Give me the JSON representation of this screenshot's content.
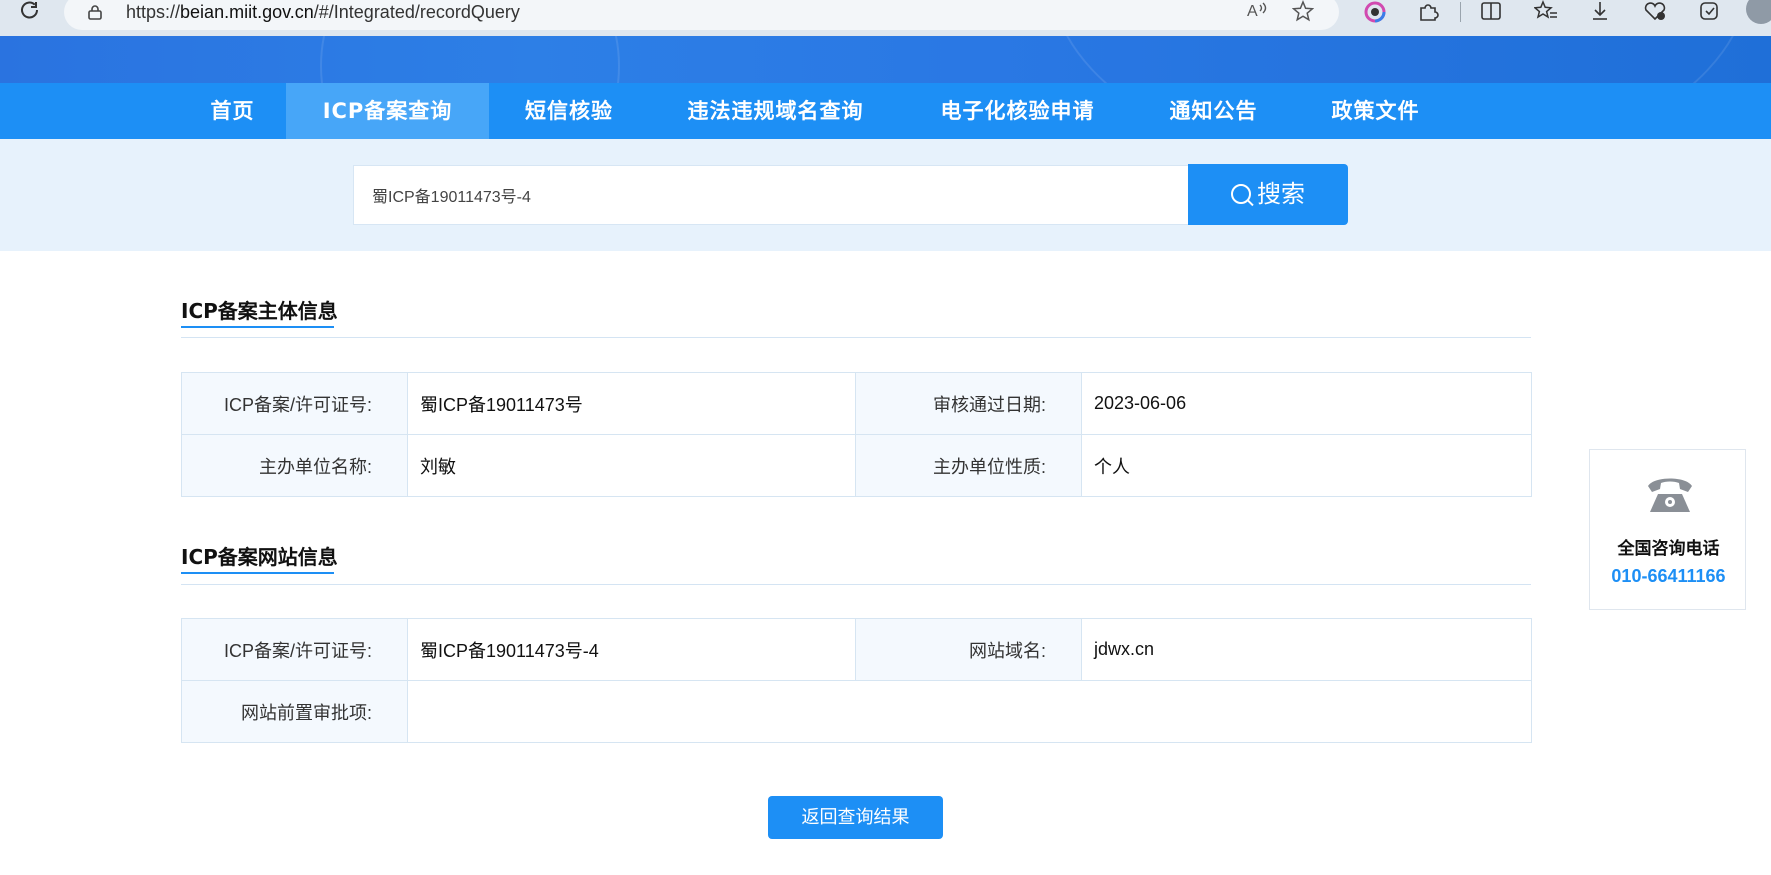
{
  "browser": {
    "url_prefix": "https://",
    "url_host": "beian.miit.gov.cn",
    "url_path": "/#/Integrated/recordQuery",
    "icons": [
      "refresh-icon",
      "lock-icon",
      "read-aloud-icon",
      "favorite-star-icon",
      "browser-essentials-icon",
      "extensions-icon",
      "split-screen-icon",
      "favorites-icon",
      "downloads-icon",
      "health-icon",
      "copilot-icon",
      "profile-avatar"
    ]
  },
  "nav": {
    "items": [
      {
        "label": "首页"
      },
      {
        "label": "ICP备案查询",
        "active": true
      },
      {
        "label": "短信核验"
      },
      {
        "label": "违法违规域名查询"
      },
      {
        "label": "电子化核验申请"
      },
      {
        "label": "通知公告"
      },
      {
        "label": "政策文件"
      }
    ]
  },
  "search": {
    "value": "蜀ICP备19011473号-4",
    "button_label": "搜索"
  },
  "subject": {
    "title": "ICP备案主体信息",
    "rows": [
      {
        "l1": "ICP备案/许可证号:",
        "v1": "蜀ICP备19011473号",
        "l2": "审核通过日期:",
        "v2": "2023-06-06"
      },
      {
        "l1": "主办单位名称:",
        "v1": "刘敏",
        "l2": "主办单位性质:",
        "v2": "个人"
      }
    ]
  },
  "website": {
    "title": "ICP备案网站信息",
    "row1": {
      "l1": "ICP备案/许可证号:",
      "v1": "蜀ICP备19011473号-4",
      "l2": "网站域名:",
      "v2": "jdwx.cn"
    },
    "row2": {
      "l1": "网站前置审批项:",
      "v1": ""
    }
  },
  "back_button": "返回查询结果",
  "contact": {
    "label": "全国咨询电话",
    "phone": "010-66411166"
  },
  "colors": {
    "primary": "#1d8ff5",
    "nav_active": "#47a6f8",
    "header_band": "#2a78e4",
    "search_bg": "#e7f2fc",
    "label_cell_bg": "#f4f9fe"
  }
}
